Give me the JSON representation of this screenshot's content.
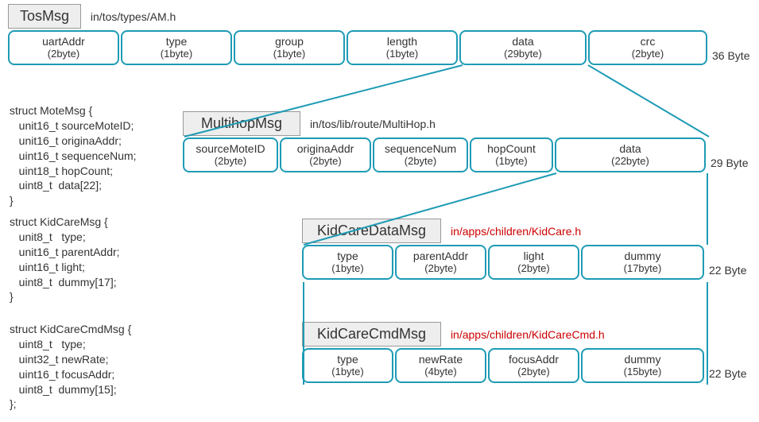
{
  "tosmsg": {
    "title": "TosMsg",
    "path": "in/tos/types/AM.h",
    "totalBytes": "36 Byte",
    "fields": [
      {
        "name": "uartAddr",
        "size": "(2byte)"
      },
      {
        "name": "type",
        "size": "(1byte)"
      },
      {
        "name": "group",
        "size": "(1byte)"
      },
      {
        "name": "length",
        "size": "(1byte)"
      },
      {
        "name": "data",
        "size": "(29byte)"
      },
      {
        "name": "crc",
        "size": "(2byte)"
      }
    ]
  },
  "multihop": {
    "title": "MultihopMsg",
    "path": "in/tos/lib/route/MultiHop.h",
    "totalBytes": "29 Byte",
    "fields": [
      {
        "name": "sourceMoteID",
        "size": "(2byte)"
      },
      {
        "name": "originaAddr",
        "size": "(2byte)"
      },
      {
        "name": "sequenceNum",
        "size": "(2byte)"
      },
      {
        "name": "hopCount",
        "size": "(1byte)"
      },
      {
        "name": "data",
        "size": "(22byte)"
      }
    ]
  },
  "kidcaredata": {
    "title": "KidCareDataMsg",
    "path": "in/apps/children/KidCare.h",
    "totalBytes": "22 Byte",
    "fields": [
      {
        "name": "type",
        "size": "(1byte)"
      },
      {
        "name": "parentAddr",
        "size": "(2byte)"
      },
      {
        "name": "light",
        "size": "(2byte)"
      },
      {
        "name": "dummy",
        "size": "(17byte)"
      }
    ]
  },
  "kidcarecmd": {
    "title": "KidCareCmdMsg",
    "path": "in/apps/children/KidCareCmd.h",
    "totalBytes": "22 Byte",
    "fields": [
      {
        "name": "type",
        "size": "(1byte)"
      },
      {
        "name": "newRate",
        "size": "(4byte)"
      },
      {
        "name": "focusAddr",
        "size": "(2byte)"
      },
      {
        "name": "dummy",
        "size": "(15byte)"
      }
    ]
  },
  "code": {
    "motemsg": "struct MoteMsg {\n   unit16_t sourceMoteID;\n   unit16_t originaAddr;\n   uint16_t sequenceNum;\n   uint18_t hopCount;\n   uint8_t  data[22];\n}",
    "kidcaremsg": "struct KidCareMsg {\n   unit8_t   type;\n   unit16_t parentAddr;\n   uint16_t light;\n   uint8_t  dummy[17];\n}",
    "kidcarecmdmsg": "struct KidCareCmdMsg {\n   uint8_t   type;\n   uint32_t newRate;\n   uint16_t focusAddr;\n   uint8_t  dummy[15];\n};"
  }
}
